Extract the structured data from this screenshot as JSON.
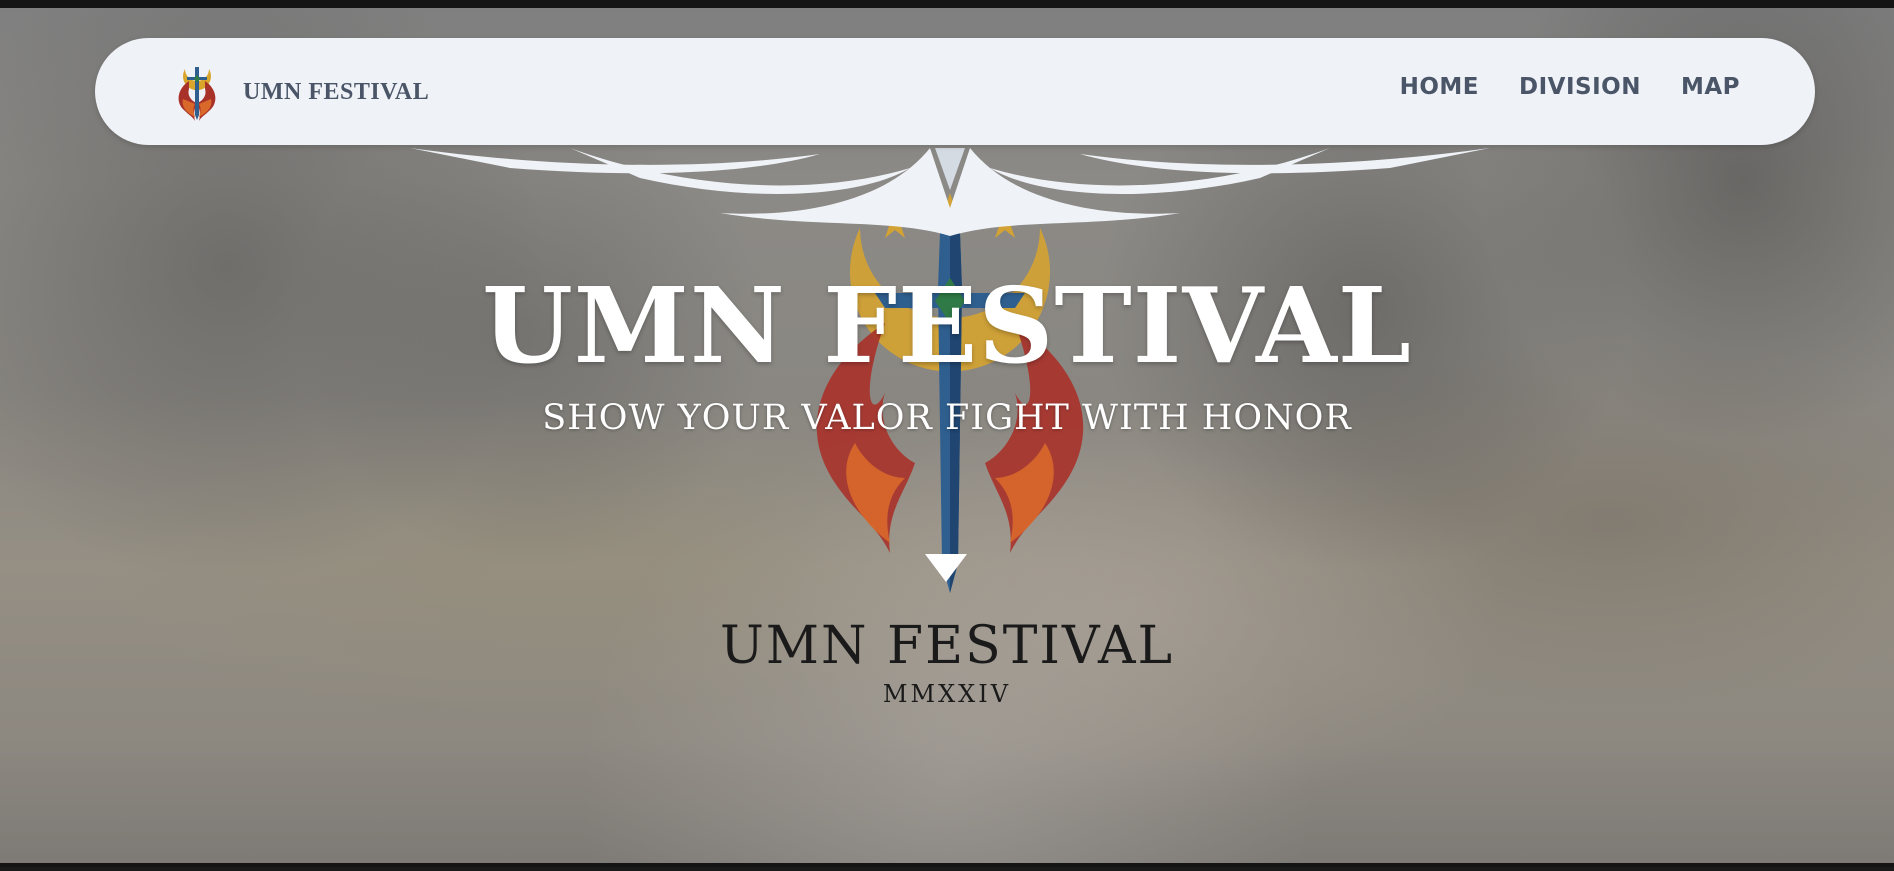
{
  "navbar": {
    "brand_text": "UMN FESTIVAL",
    "logo_icon": "sword-flame-logo-icon",
    "links": [
      {
        "label": "HOME"
      },
      {
        "label": "DIVISION"
      },
      {
        "label": "MAP"
      }
    ]
  },
  "hero": {
    "title": "UMN FESTIVAL",
    "subtitle": "SHOW YOUR VALOR FIGHT WITH HONOR",
    "emblem_name": "UMN FESTIVAL",
    "emblem_year": "MMXXIV",
    "scroll_icon": "triangle-down-icon"
  },
  "colors": {
    "navbar_bg": "#eff2f7",
    "nav_text": "#4a5568",
    "hero_text": "#ffffff",
    "flame_red": "#a8322a",
    "flame_orange": "#d9682b",
    "sword_blue": "#2f5f8f",
    "moon_gold": "#d9a52b",
    "gem_green": "#2f7a46"
  }
}
